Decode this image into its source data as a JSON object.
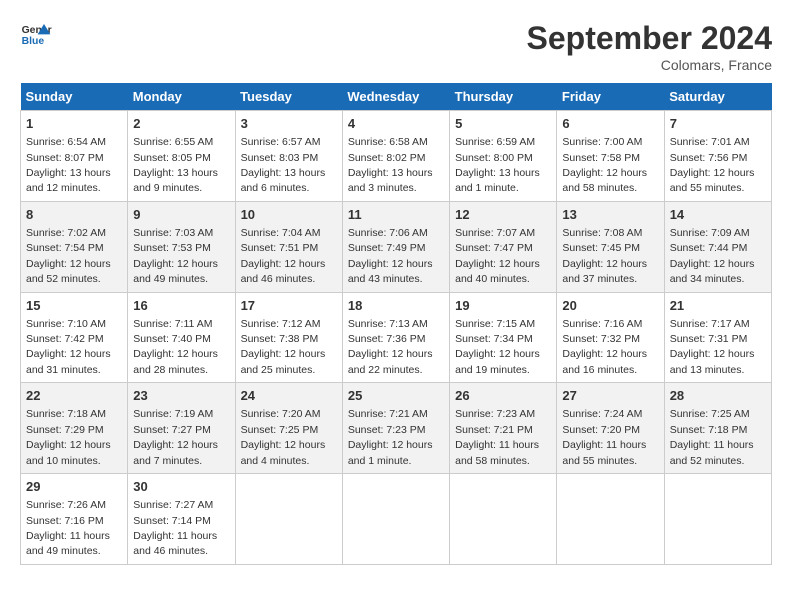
{
  "logo": {
    "line1": "General",
    "line2": "Blue"
  },
  "title": "September 2024",
  "location": "Colomars, France",
  "days_of_week": [
    "Sunday",
    "Monday",
    "Tuesday",
    "Wednesday",
    "Thursday",
    "Friday",
    "Saturday"
  ],
  "weeks": [
    [
      {
        "day": "1",
        "sunrise": "6:54 AM",
        "sunset": "8:07 PM",
        "daylight": "13 hours and 12 minutes."
      },
      {
        "day": "2",
        "sunrise": "6:55 AM",
        "sunset": "8:05 PM",
        "daylight": "13 hours and 9 minutes."
      },
      {
        "day": "3",
        "sunrise": "6:57 AM",
        "sunset": "8:03 PM",
        "daylight": "13 hours and 6 minutes."
      },
      {
        "day": "4",
        "sunrise": "6:58 AM",
        "sunset": "8:02 PM",
        "daylight": "13 hours and 3 minutes."
      },
      {
        "day": "5",
        "sunrise": "6:59 AM",
        "sunset": "8:00 PM",
        "daylight": "13 hours and 1 minute."
      },
      {
        "day": "6",
        "sunrise": "7:00 AM",
        "sunset": "7:58 PM",
        "daylight": "12 hours and 58 minutes."
      },
      {
        "day": "7",
        "sunrise": "7:01 AM",
        "sunset": "7:56 PM",
        "daylight": "12 hours and 55 minutes."
      }
    ],
    [
      {
        "day": "8",
        "sunrise": "7:02 AM",
        "sunset": "7:54 PM",
        "daylight": "12 hours and 52 minutes."
      },
      {
        "day": "9",
        "sunrise": "7:03 AM",
        "sunset": "7:53 PM",
        "daylight": "12 hours and 49 minutes."
      },
      {
        "day": "10",
        "sunrise": "7:04 AM",
        "sunset": "7:51 PM",
        "daylight": "12 hours and 46 minutes."
      },
      {
        "day": "11",
        "sunrise": "7:06 AM",
        "sunset": "7:49 PM",
        "daylight": "12 hours and 43 minutes."
      },
      {
        "day": "12",
        "sunrise": "7:07 AM",
        "sunset": "7:47 PM",
        "daylight": "12 hours and 40 minutes."
      },
      {
        "day": "13",
        "sunrise": "7:08 AM",
        "sunset": "7:45 PM",
        "daylight": "12 hours and 37 minutes."
      },
      {
        "day": "14",
        "sunrise": "7:09 AM",
        "sunset": "7:44 PM",
        "daylight": "12 hours and 34 minutes."
      }
    ],
    [
      {
        "day": "15",
        "sunrise": "7:10 AM",
        "sunset": "7:42 PM",
        "daylight": "12 hours and 31 minutes."
      },
      {
        "day": "16",
        "sunrise": "7:11 AM",
        "sunset": "7:40 PM",
        "daylight": "12 hours and 28 minutes."
      },
      {
        "day": "17",
        "sunrise": "7:12 AM",
        "sunset": "7:38 PM",
        "daylight": "12 hours and 25 minutes."
      },
      {
        "day": "18",
        "sunrise": "7:13 AM",
        "sunset": "7:36 PM",
        "daylight": "12 hours and 22 minutes."
      },
      {
        "day": "19",
        "sunrise": "7:15 AM",
        "sunset": "7:34 PM",
        "daylight": "12 hours and 19 minutes."
      },
      {
        "day": "20",
        "sunrise": "7:16 AM",
        "sunset": "7:32 PM",
        "daylight": "12 hours and 16 minutes."
      },
      {
        "day": "21",
        "sunrise": "7:17 AM",
        "sunset": "7:31 PM",
        "daylight": "12 hours and 13 minutes."
      }
    ],
    [
      {
        "day": "22",
        "sunrise": "7:18 AM",
        "sunset": "7:29 PM",
        "daylight": "12 hours and 10 minutes."
      },
      {
        "day": "23",
        "sunrise": "7:19 AM",
        "sunset": "7:27 PM",
        "daylight": "12 hours and 7 minutes."
      },
      {
        "day": "24",
        "sunrise": "7:20 AM",
        "sunset": "7:25 PM",
        "daylight": "12 hours and 4 minutes."
      },
      {
        "day": "25",
        "sunrise": "7:21 AM",
        "sunset": "7:23 PM",
        "daylight": "12 hours and 1 minute."
      },
      {
        "day": "26",
        "sunrise": "7:23 AM",
        "sunset": "7:21 PM",
        "daylight": "11 hours and 58 minutes."
      },
      {
        "day": "27",
        "sunrise": "7:24 AM",
        "sunset": "7:20 PM",
        "daylight": "11 hours and 55 minutes."
      },
      {
        "day": "28",
        "sunrise": "7:25 AM",
        "sunset": "7:18 PM",
        "daylight": "11 hours and 52 minutes."
      }
    ],
    [
      {
        "day": "29",
        "sunrise": "7:26 AM",
        "sunset": "7:16 PM",
        "daylight": "11 hours and 49 minutes."
      },
      {
        "day": "30",
        "sunrise": "7:27 AM",
        "sunset": "7:14 PM",
        "daylight": "11 hours and 46 minutes."
      },
      null,
      null,
      null,
      null,
      null
    ]
  ]
}
